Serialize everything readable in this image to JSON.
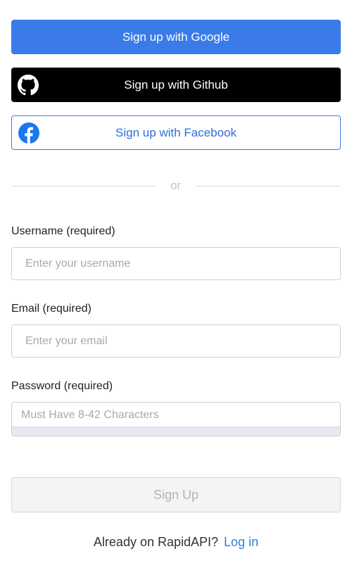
{
  "social": {
    "google_label": "Sign up with Google",
    "github_label": "Sign up with Github",
    "facebook_label": "Sign up with Facebook"
  },
  "divider": {
    "text": "or"
  },
  "form": {
    "username": {
      "label": "Username (required)",
      "placeholder": "Enter your username",
      "value": ""
    },
    "email": {
      "label": "Email (required)",
      "placeholder": "Enter your email",
      "value": ""
    },
    "password": {
      "label": "Password (required)",
      "placeholder": "Must Have 8-42 Characters",
      "value": ""
    },
    "submit_label": "Sign Up"
  },
  "footer": {
    "prompt": "Already on RapidAPI?",
    "login_label": "Log in"
  },
  "colors": {
    "google_blue": "#3a7be9",
    "github_black": "#000000",
    "link_blue": "#2f7fe0"
  },
  "icons": {
    "github": "github-icon",
    "facebook": "facebook-icon"
  }
}
